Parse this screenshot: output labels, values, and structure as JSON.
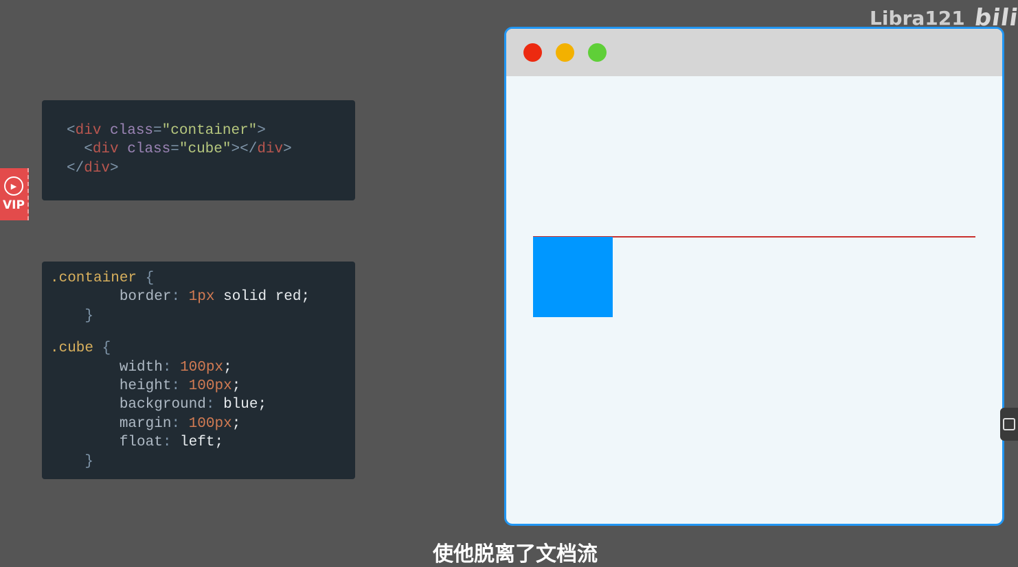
{
  "watermark": {
    "text": "Libra121",
    "logo": "bili"
  },
  "vip_badge": {
    "label": "VIP",
    "icon": "play-icon"
  },
  "html_code": {
    "line1": {
      "open": "<",
      "tag": "div",
      "attr": " class",
      "eq": "=",
      "value": "\"container\"",
      "close": ">"
    },
    "line2": {
      "open": "<",
      "tag": "div",
      "attr": " class",
      "eq": "=",
      "value": "\"cube\"",
      "close": "></",
      "tag2": "div",
      "close2": ">"
    },
    "line3": {
      "open": "</",
      "tag": "div",
      "close": ">"
    }
  },
  "css_code": {
    "container_selector": ".container",
    "open_brace": " {",
    "close_brace": "}",
    "container_rules": [
      {
        "prop": "border",
        "num": "1px",
        "rest": " solid red;"
      }
    ],
    "cube_selector": ".cube",
    "cube_rules": [
      {
        "prop": "width",
        "num": "100px",
        "rest": ";"
      },
      {
        "prop": "height",
        "num": "100px",
        "rest": ";"
      },
      {
        "prop": "background",
        "num": "",
        "rest": " blue;"
      },
      {
        "prop": "margin",
        "num": "100px",
        "rest": ";"
      },
      {
        "prop": "float",
        "num": "",
        "rest": " left;"
      }
    ]
  },
  "browser": {
    "traffic_lights": [
      "close-dot",
      "minimize-dot",
      "maximize-dot"
    ],
    "colors": {
      "border": "#2196f3",
      "container_border": "#c9302c",
      "cube": "#0097ff"
    }
  },
  "subtitle": "使他脱离了文档流"
}
